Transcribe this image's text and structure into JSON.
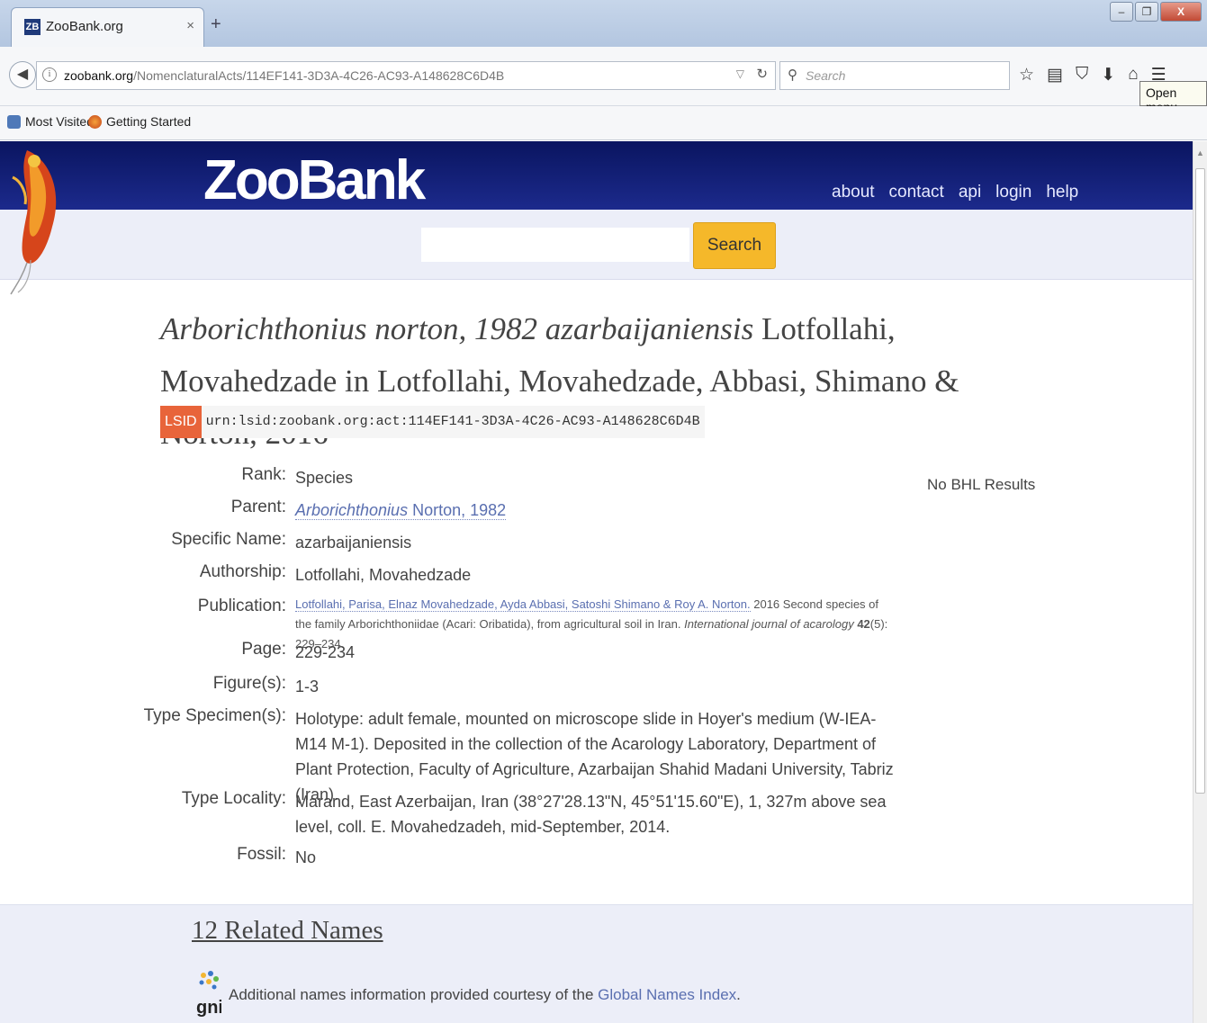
{
  "browser": {
    "tab_title": "ZooBank.org",
    "tab_favicon": "ZB",
    "tab_close": "×",
    "new_tab": "+",
    "url_host": "zoobank.org",
    "url_path": "/NomenclaturalActs/114EF141-3D3A-4C26-AC93-A148628C6D4B",
    "search_placeholder": "Search",
    "tooltip": "Open menu",
    "bookmarks": [
      "Most Visited",
      "Getting Started"
    ],
    "window_close": "X"
  },
  "site": {
    "logo": "ZooBank",
    "nav": [
      "about",
      "contact",
      "api",
      "login",
      "help"
    ],
    "search_button": "Search"
  },
  "record": {
    "title_italic_1": "Arborichthonius norton, 1982 azarbaijaniensis",
    "title_rest": " Lotfollahi, Movahedzade in Lotfollahi, Movahedzade, Abbasi, Shimano & Norton, 2016",
    "lsid_badge": "LSID",
    "lsid_value": "urn:lsid:zoobank.org:act:114EF141-3D3A-4C26-AC93-A148628C6D4B",
    "bhl": "No BHL Results",
    "labels": {
      "rank": "Rank:",
      "parent": "Parent:",
      "specific_name": "Specific Name:",
      "authorship": "Authorship:",
      "publication": "Publication:",
      "page": "Page:",
      "figures": "Figure(s):",
      "type_specimen": "Type Specimen(s):",
      "type_locality": "Type Locality:",
      "fossil": "Fossil:"
    },
    "values": {
      "rank": "Species",
      "parent_genus": "Arborichthonius",
      "parent_author": " Norton, 1982",
      "specific_name": "azarbaijaniensis",
      "authorship": "Lotfollahi, Movahedzade",
      "publication_authors": "Lotfollahi, Parisa, Elnaz Movahedzade, Ayda Abbasi, Satoshi Shimano & Roy A. Norton.",
      "publication_rest": " 2016 Second species of the family Arborichthoniidae (Acari: Oribatida), from agricultural soil in Iran. ",
      "publication_journal": "International journal of acarology",
      "publication_volume": " 42",
      "publication_pages": "(5): 229–234.",
      "page": "229-234",
      "figures": "1-3",
      "type_specimen": "Holotype: adult female, mounted on microscope slide in Hoyer's medium (W-IEA-M14 M-1). Deposited in the collection of the Acarology Laboratory, Department of Plant Protection, Faculty of Agriculture, Azarbaijan Shahid Madani University, Tabriz (Iran).",
      "type_locality": "Marand, East Azerbaijan, Iran (38°27'28.13\"N, 45°51'15.60\"E), 1, 327m above sea level, coll. E. Movahedzadeh, mid-September, 2014.",
      "fossil": "No"
    }
  },
  "related": {
    "title": "12 Related Names",
    "gni_text": "Additional names information provided courtesy of the ",
    "gni_link": "Global Names Index",
    "gni_after": ".",
    "gni_logo_text": "gni"
  }
}
